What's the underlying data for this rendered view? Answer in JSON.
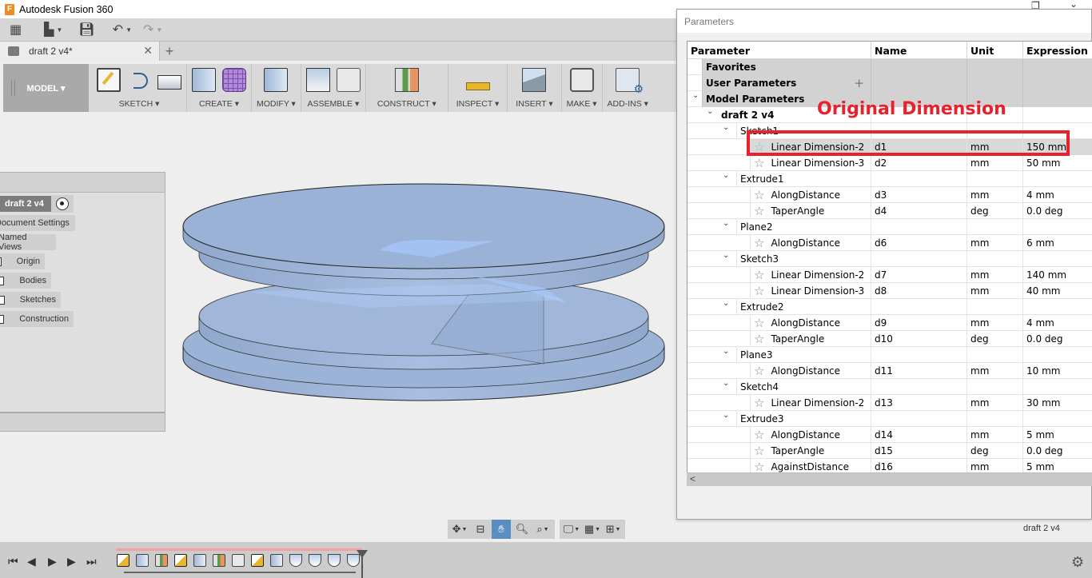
{
  "app": {
    "title": "Autodesk Fusion 360",
    "logo_letter": "F"
  },
  "quick_access": [
    {
      "name": "data-panel",
      "icon": "grid-icon"
    },
    {
      "name": "file",
      "icon": "file-icon"
    },
    {
      "name": "save",
      "icon": "save-icon"
    },
    {
      "name": "undo",
      "icon": "undo-icon"
    },
    {
      "name": "redo",
      "icon": "redo-icon"
    }
  ],
  "document_tab": {
    "label": "draft 2 v4*"
  },
  "ribbon": {
    "workspace": "MODEL ▾",
    "groups": [
      {
        "label": "SKETCH ▾",
        "icons": [
          "create-sketch-icon",
          "arc-icon",
          "rectangle-icon"
        ]
      },
      {
        "label": "CREATE ▾",
        "icons": [
          "extrude-icon",
          "create-form-icon"
        ]
      },
      {
        "label": "MODIFY ▾",
        "icons": [
          "press-pull-icon"
        ]
      },
      {
        "label": "ASSEMBLE ▾",
        "icons": [
          "new-component-icon",
          "joint-icon"
        ]
      },
      {
        "label": "CONSTRUCT ▾",
        "icons": [
          "offset-plane-icon"
        ]
      },
      {
        "label": "INSPECT ▾",
        "icons": [
          "measure-icon"
        ]
      },
      {
        "label": "INSERT ▾",
        "icons": [
          "insert-image-icon"
        ]
      },
      {
        "label": "MAKE ▾",
        "icons": [
          "3d-print-icon"
        ]
      },
      {
        "label": "ADD-INS ▾",
        "icons": [
          "scripts-icon"
        ]
      }
    ]
  },
  "browser": {
    "root": "draft 2 v4",
    "items": [
      "Document Settings",
      "Named Views",
      "Origin",
      "Bodies",
      "Sketches",
      "Construction"
    ]
  },
  "navbar": {
    "buttons": [
      "orbit",
      "look-at",
      "pan",
      "zoom",
      "fit",
      "display-settings",
      "grid-settings",
      "viewports"
    ],
    "active": "pan"
  },
  "status": {
    "document": "draft 2 v4"
  },
  "timeline": {
    "controls": [
      "first",
      "previous",
      "play",
      "next",
      "last"
    ],
    "features": [
      "sketch",
      "extrude",
      "plane",
      "sketch",
      "extrude",
      "plane",
      "joint",
      "sketch",
      "extrude",
      "chamfer",
      "chamfer",
      "chamfer",
      "chamfer"
    ]
  },
  "dialog": {
    "title": "Parameters",
    "columns": [
      "Parameter",
      "Name",
      "Unit",
      "Expression"
    ],
    "groups": [
      "Favorites",
      "User Parameters",
      "Model Parameters"
    ],
    "component": "draft 2 v4",
    "features": [
      {
        "name": "Sketch1",
        "params": [
          {
            "param": "Linear Dimension-2",
            "name": "d1",
            "unit": "mm",
            "expr": "150 mm",
            "selected": true
          },
          {
            "param": "Linear Dimension-3",
            "name": "d2",
            "unit": "mm",
            "expr": "50 mm"
          }
        ]
      },
      {
        "name": "Extrude1",
        "params": [
          {
            "param": "AlongDistance",
            "name": "d3",
            "unit": "mm",
            "expr": "4 mm"
          },
          {
            "param": "TaperAngle",
            "name": "d4",
            "unit": "deg",
            "expr": "0.0 deg"
          }
        ]
      },
      {
        "name": "Plane2",
        "params": [
          {
            "param": "AlongDistance",
            "name": "d6",
            "unit": "mm",
            "expr": "6 mm"
          }
        ]
      },
      {
        "name": "Sketch3",
        "params": [
          {
            "param": "Linear Dimension-2",
            "name": "d7",
            "unit": "mm",
            "expr": "140 mm"
          },
          {
            "param": "Linear Dimension-3",
            "name": "d8",
            "unit": "mm",
            "expr": "40 mm"
          }
        ]
      },
      {
        "name": "Extrude2",
        "params": [
          {
            "param": "AlongDistance",
            "name": "d9",
            "unit": "mm",
            "expr": "4 mm"
          },
          {
            "param": "TaperAngle",
            "name": "d10",
            "unit": "deg",
            "expr": "0.0 deg"
          }
        ]
      },
      {
        "name": "Plane3",
        "params": [
          {
            "param": "AlongDistance",
            "name": "d11",
            "unit": "mm",
            "expr": "10 mm"
          }
        ]
      },
      {
        "name": "Sketch4",
        "params": [
          {
            "param": "Linear Dimension-2",
            "name": "d13",
            "unit": "mm",
            "expr": "30 mm"
          }
        ]
      },
      {
        "name": "Extrude3",
        "params": [
          {
            "param": "AlongDistance",
            "name": "d14",
            "unit": "mm",
            "expr": "5 mm"
          },
          {
            "param": "TaperAngle",
            "name": "d15",
            "unit": "deg",
            "expr": "0.0 deg"
          },
          {
            "param": "AgainstDistance",
            "name": "d16",
            "unit": "mm",
            "expr": "5 mm"
          }
        ]
      }
    ]
  },
  "annotation": {
    "text": "Original Dimension",
    "color": "#e8212b"
  },
  "colors": {
    "body": "#9bb3d6",
    "body_edge": "#222222",
    "active_nav": "#5b8ec0"
  }
}
